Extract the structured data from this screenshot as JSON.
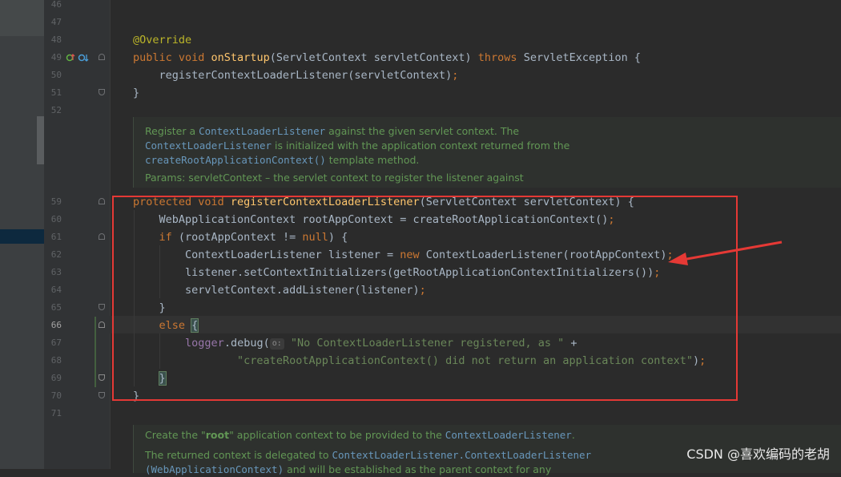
{
  "line_numbers": {
    "l46": "46",
    "l47": "47",
    "l48": "48",
    "l49": "49",
    "l50": "50",
    "l51": "51",
    "l52": "52",
    "l59": "59",
    "l60": "60",
    "l61": "61",
    "l62": "62",
    "l63": "63",
    "l64": "64",
    "l65": "65",
    "l66": "66",
    "l67": "67",
    "l68": "68",
    "l69": "69",
    "l70": "70",
    "l71": "71"
  },
  "code": {
    "override": "@Override",
    "l49": {
      "kw": "public void ",
      "fn": "onStartup",
      "rest1": "(ServletContext servletContext) ",
      "throws": "throws",
      "rest2": " ServletException {"
    },
    "l50": {
      "text": "    registerContextLoaderListener(servletContext)",
      "semi": ";"
    },
    "l51": "}",
    "l59": {
      "kw": "protected void ",
      "fn": "registerContextLoaderListener",
      "rest": "(ServletContext servletContext) {"
    },
    "l60": {
      "text": "    WebApplicationContext rootAppContext = createRootApplicationContext()",
      "semi": ";"
    },
    "l61": {
      "indent": "    ",
      "kw": "if",
      "mid": " (rootAppContext != ",
      "kw2": "null",
      "end": ") {"
    },
    "l62": {
      "a": "        ContextLoaderListener listener = ",
      "kw": "new",
      "b": " ContextLoaderListener(rootAppContext)",
      "semi": ";"
    },
    "l63": {
      "text": "        listener.setContextInitializers(getRootApplicationContextInitializers())",
      "semi": ";"
    },
    "l64": {
      "text": "        servletContext.addListener(listener)",
      "semi": ";"
    },
    "l65": "    }",
    "l66": {
      "indent": "    ",
      "kw": "else ",
      "brace": "{"
    },
    "l67": {
      "indent": "        ",
      "field": "logger",
      "a": ".debug(",
      "hint": "o:",
      "str": "\"No ContextLoaderListener registered, as \"",
      "end": " +"
    },
    "l68": {
      "indent": "                ",
      "str": "\"createRootApplicationContext() did not return an application context\"",
      "end": ")",
      "semi": ";"
    },
    "l69": {
      "indent": "    ",
      "brace": "}"
    },
    "l70": "}"
  },
  "doc1": {
    "line1_a": "Register a ",
    "line1_link": "ContextLoaderListener",
    "line1_b": " against the given servlet context. The",
    "line2_link": "ContextLoaderListener",
    "line2_b": " is initialized with the application context returned from the",
    "line3_link": "createRootApplicationContext()",
    "line3_b": " template method.",
    "line4": "Params: servletContext – the servlet context to register the listener against"
  },
  "doc2": {
    "line1_a": "Create the \"",
    "line1_bold": "root",
    "line1_b": "\" application context to be provided to the ",
    "line1_link": "ContextLoaderListener",
    "line1_c": ".",
    "line2_a": "The returned context is delegated to ",
    "line2_link": "ContextLoaderListener.ContextLoaderListener",
    "line3_link": "(WebApplicationContext)",
    "line3_b": " and will be established as the parent context for any"
  },
  "watermark": "CSDN @喜欢编码的老胡",
  "colors": {
    "annotation_box": "#e53935",
    "arrow": "#e53935",
    "background": "#2b2b2b"
  },
  "gutter_icons": [
    "override-up-icon",
    "implemented-down-icon"
  ]
}
